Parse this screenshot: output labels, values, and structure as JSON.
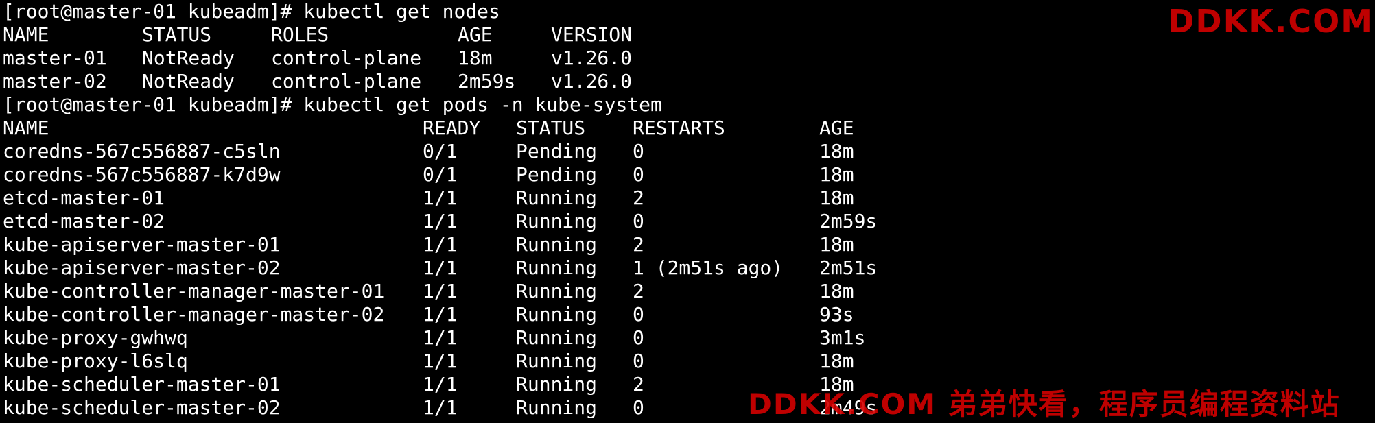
{
  "prompt1": "[root@master-01 kubeadm]# kubectl get nodes",
  "nodes": {
    "headers": {
      "name": "NAME",
      "status": "STATUS",
      "roles": "ROLES",
      "age": "AGE",
      "version": "VERSION"
    },
    "rows": [
      {
        "name": "master-01",
        "status": "NotReady",
        "roles": "control-plane",
        "age": "18m",
        "version": "v1.26.0"
      },
      {
        "name": "master-02",
        "status": "NotReady",
        "roles": "control-plane",
        "age": "2m59s",
        "version": "v1.26.0"
      }
    ]
  },
  "prompt2": "[root@master-01 kubeadm]# kubectl get pods -n kube-system",
  "pods": {
    "headers": {
      "name": "NAME",
      "ready": "READY",
      "status": "STATUS",
      "restarts": "RESTARTS",
      "age": "AGE"
    },
    "rows": [
      {
        "name": "coredns-567c556887-c5sln",
        "ready": "0/1",
        "status": "Pending",
        "restarts": "0",
        "age": "18m"
      },
      {
        "name": "coredns-567c556887-k7d9w",
        "ready": "0/1",
        "status": "Pending",
        "restarts": "0",
        "age": "18m"
      },
      {
        "name": "etcd-master-01",
        "ready": "1/1",
        "status": "Running",
        "restarts": "2",
        "age": "18m"
      },
      {
        "name": "etcd-master-02",
        "ready": "1/1",
        "status": "Running",
        "restarts": "0",
        "age": "2m59s"
      },
      {
        "name": "kube-apiserver-master-01",
        "ready": "1/1",
        "status": "Running",
        "restarts": "2",
        "age": "18m"
      },
      {
        "name": "kube-apiserver-master-02",
        "ready": "1/1",
        "status": "Running",
        "restarts": "1 (2m51s ago)",
        "age": "2m51s"
      },
      {
        "name": "kube-controller-manager-master-01",
        "ready": "1/1",
        "status": "Running",
        "restarts": "2",
        "age": "18m"
      },
      {
        "name": "kube-controller-manager-master-02",
        "ready": "1/1",
        "status": "Running",
        "restarts": "0",
        "age": "93s"
      },
      {
        "name": "kube-proxy-gwhwq",
        "ready": "1/1",
        "status": "Running",
        "restarts": "0",
        "age": "3m1s"
      },
      {
        "name": "kube-proxy-l6slq",
        "ready": "1/1",
        "status": "Running",
        "restarts": "0",
        "age": "18m"
      },
      {
        "name": "kube-scheduler-master-01",
        "ready": "1/1",
        "status": "Running",
        "restarts": "2",
        "age": "18m"
      },
      {
        "name": "kube-scheduler-master-02",
        "ready": "1/1",
        "status": "Running",
        "restarts": "0",
        "age": "2m49s"
      }
    ]
  },
  "watermark": {
    "top": "DDKK.COM",
    "bottom": "DDKK.COM 弟弟快看，程序员编程资料站"
  },
  "colors": {
    "background": "#000000",
    "text": "#ffffff",
    "watermark": "#d40000"
  }
}
